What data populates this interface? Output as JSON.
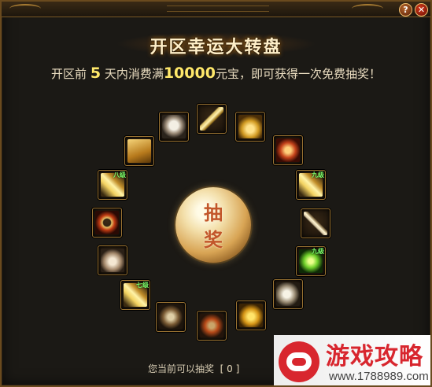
{
  "window": {
    "help_label": "?",
    "close_label": "✕"
  },
  "title": "开区幸运大转盘",
  "subtitle": {
    "part1": "开区前 ",
    "days": "5",
    "part2": " 天内消费满",
    "amount": "10000",
    "part3": "元宝，即可获得一次免费抽奖！"
  },
  "wheel": {
    "items": [
      {
        "icon": "skull-helmet-icon",
        "level": ""
      },
      {
        "icon": "golden-sword-icon",
        "level": ""
      },
      {
        "icon": "golden-crown-icon",
        "level": ""
      },
      {
        "icon": "fire-armor-icon",
        "level": ""
      },
      {
        "icon": "skill-book-icon",
        "level": "九级"
      },
      {
        "icon": "bone-staff-icon",
        "level": ""
      },
      {
        "icon": "green-skill-book-icon",
        "level": "九级"
      },
      {
        "icon": "white-feather-armor-icon",
        "level": ""
      },
      {
        "icon": "golden-claw-icon",
        "level": ""
      },
      {
        "icon": "dark-helmet-icon",
        "level": ""
      },
      {
        "icon": "crossed-weapons-icon",
        "level": ""
      },
      {
        "icon": "skill-book-icon",
        "level": "七级"
      },
      {
        "icon": "silver-gauntlet-icon",
        "level": ""
      },
      {
        "icon": "fire-ring-icon",
        "level": ""
      },
      {
        "icon": "skill-book-icon",
        "level": "八级"
      },
      {
        "icon": "ancient-scroll-icon",
        "level": ""
      }
    ]
  },
  "draw_button": {
    "line1": "抽",
    "line2": "奖"
  },
  "bottom": {
    "label": "您当前可以抽奖",
    "count_display": "[ 0 ]"
  },
  "watermark": {
    "title": "游戏攻略",
    "url": "www.1788989.com"
  }
}
